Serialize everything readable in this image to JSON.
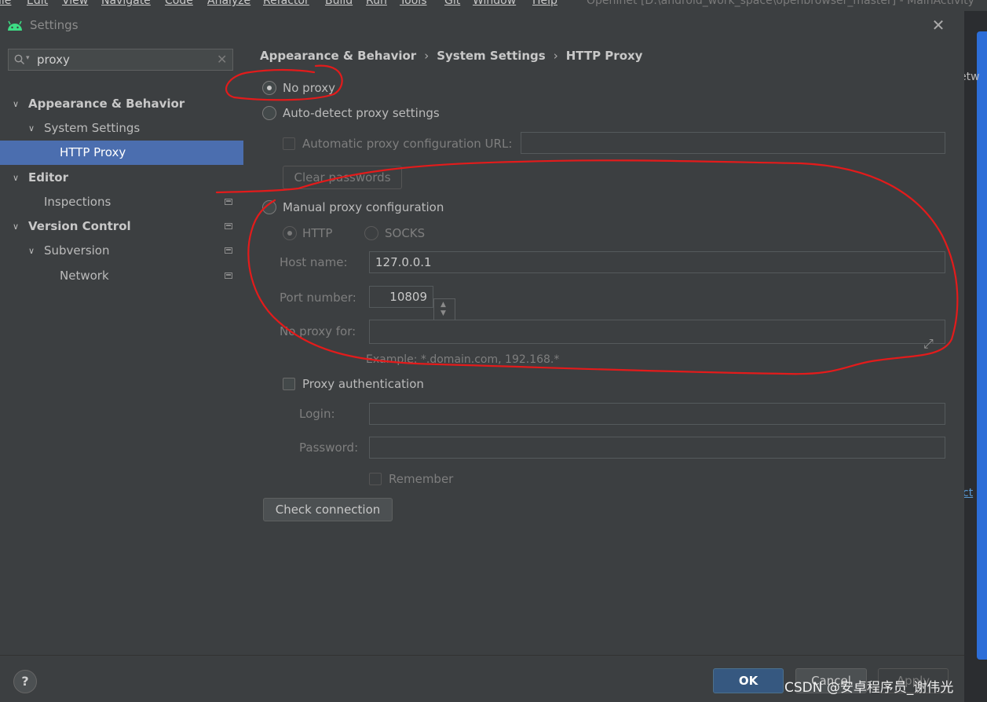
{
  "menubar": {
    "items": [
      "ile",
      "Edit",
      "View",
      "Navigate",
      "Code",
      "Analyze",
      "Refactor",
      "Build",
      "Run",
      "Tools",
      "Git",
      "Window",
      "Help"
    ],
    "title": "OpenInet [D:\\android_work_space\\openbrowser_master] - MainActivity"
  },
  "dialog": {
    "title": "Settings"
  },
  "sidebar": {
    "search_value": "proxy",
    "items": [
      {
        "label": "Appearance & Behavior",
        "bold": true,
        "expanded": true
      },
      {
        "label": "System Settings",
        "bold": false,
        "expanded": true
      },
      {
        "label": "HTTP Proxy",
        "bold": false,
        "selected": true
      },
      {
        "label": "Editor",
        "bold": true,
        "expanded": true
      },
      {
        "label": "Inspections",
        "bold": false
      },
      {
        "label": "Version Control",
        "bold": true,
        "expanded": true
      },
      {
        "label": "Subversion",
        "bold": false,
        "expanded": true
      },
      {
        "label": "Network",
        "bold": false
      }
    ]
  },
  "breadcrumb": {
    "part1": "Appearance & Behavior",
    "part2": "System Settings",
    "part3": "HTTP Proxy"
  },
  "proxy": {
    "no_proxy": "No proxy",
    "auto_detect": "Auto-detect proxy settings",
    "auto_url_label": "Automatic proxy configuration URL:",
    "auto_url_value": "",
    "clear_passwords": "Clear passwords",
    "manual": "Manual proxy configuration",
    "http": "HTTP",
    "socks": "SOCKS",
    "host_label": "Host name:",
    "host_value": "127.0.0.1",
    "port_label": "Port number:",
    "port_value": "10809",
    "no_proxy_for_label": "No proxy for:",
    "no_proxy_for_value": "",
    "example": "Example: *.domain.com, 192.168.*",
    "auth": "Proxy authentication",
    "login_label": "Login:",
    "password_label": "Password:",
    "remember": "Remember",
    "check_connection": "Check connection"
  },
  "footer": {
    "help": "?",
    "ok": "OK",
    "cancel": "Cancel",
    "apply": "Apply"
  },
  "right_edge": {
    "text1": "etw",
    "text2": "ct"
  },
  "watermark": "CSDN @安卓程序员_谢伟光",
  "colors": {
    "selection": "#4b6eaf",
    "ok_button": "#365880",
    "annotation": "#e31b1b"
  }
}
